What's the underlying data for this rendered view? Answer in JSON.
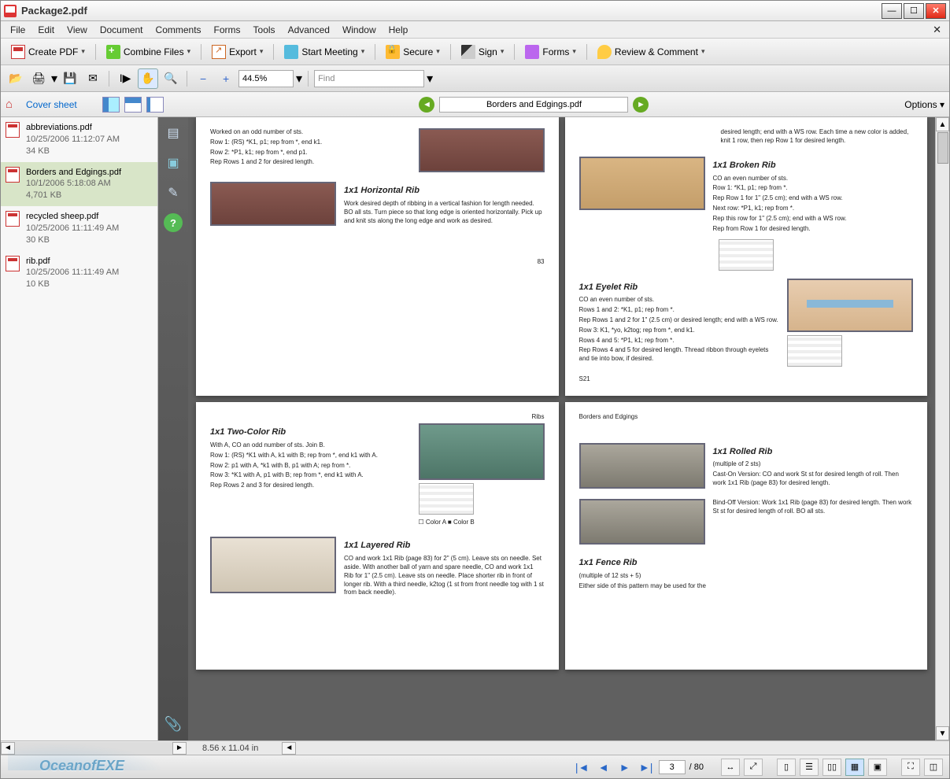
{
  "window": {
    "title": "Package2.pdf"
  },
  "menu": [
    "File",
    "Edit",
    "View",
    "Document",
    "Comments",
    "Forms",
    "Tools",
    "Advanced",
    "Window",
    "Help"
  ],
  "toolbar1": {
    "create": "Create PDF",
    "combine": "Combine Files",
    "export": "Export",
    "meeting": "Start Meeting",
    "secure": "Secure",
    "sign": "Sign",
    "forms": "Forms",
    "review": "Review & Comment"
  },
  "toolbar2": {
    "zoom": "44.5%",
    "find": "Find"
  },
  "navbar": {
    "cover": "Cover sheet",
    "doc": "Borders and Edgings.pdf",
    "options": "Options"
  },
  "files": [
    {
      "name": "abbreviations.pdf",
      "date": "10/25/2006 11:12:07 AM",
      "size": "34 KB"
    },
    {
      "name": "Borders and Edgings.pdf",
      "date": "10/1/2006 5:18:08 AM",
      "size": "4,701 KB"
    },
    {
      "name": "recycled sheep.pdf",
      "date": "10/25/2006 11:11:49 AM",
      "size": "30 KB"
    },
    {
      "name": "rib.pdf",
      "date": "10/25/2006 11:11:49 AM",
      "size": "10 KB"
    }
  ],
  "doc": {
    "p1": {
      "t1": "Worked on an odd number of sts.",
      "t2": "Row 1: (RS) *K1, p1; rep from *, end k1.",
      "t3": "Row 2: *P1, k1; rep from *, end p1.",
      "t4": "Rep Rows 1 and 2 for desired length.",
      "h2": "1x1   Horizontal   Rib",
      "t5": "Work desired depth of ribbing in a vertical fashion for length needed. BO all sts. Turn piece so that long edge is oriented horizontally. Pick up and knit sts along the long edge and work as desired.",
      "pg": "83"
    },
    "p2": {
      "t1": "desired length; end with a WS row. Each time a new color is added, knit 1 row, then rep Row 1 for desired length.",
      "h1": "1x1   Broken   Rib",
      "t2": "CO an even number of sts.",
      "t3": "Row 1: *K1, p1; rep from *.",
      "t4": "Rep Row 1 for 1\" (2.5 cm); end with a WS row.",
      "t5": "Next row: *P1, k1; rep from *.",
      "t6": "Rep this row for 1\" (2.5 cm); end with a WS row.",
      "t7": "Rep from Row 1 for desired length.",
      "h2": "1x1  Eyelet  Rib",
      "e1": "CO an even number of sts.",
      "e2": "Rows 1 and 2: *K1, p1; rep from *.",
      "e3": "Rep Rows 1 and 2 for 1\" (2.5 cm) or desired length; end with a WS row.",
      "e4": "Row 3: K1, *yo, k2tog; rep from *, end k1.",
      "e5": "Rows 4 and 5: *P1, k1; rep from *.",
      "e6": "Rep Rows 4 and 5 for desired length. Thread ribbon through eyelets and tie into bow, if desired.",
      "pg": "S21"
    },
    "p3": {
      "cat": "Ribs",
      "h1": "1x1   Two-Color   Rib",
      "t1": "With A, CO an odd number of sts. Join B.",
      "t2": "Row 1: (RS) *K1 with A, k1 with B; rep from *, end k1 with A.",
      "t3": "Row 2: p1 with A, *k1 with B, p1 with A; rep from *.",
      "t4": "Row 3: *K1 with A, p1 with B; rep from *, end k1 with A.",
      "t5": "Rep Rows 2 and 3 for desired length.",
      "h2": "1x1  Layered  Rib",
      "l1": "CO and work 1x1 Rib (page 83) for 2\" (5 cm). Leave sts on needle. Set aside. With another ball of yarn and spare needle, CO and work 1x1 Rib for 1\" (2.5 cm). Leave sts on needle. Place shorter rib in front of longer rib. With a third needle, k2tog (1 st from front needle tog with 1 st from back needle).",
      "ca": "Color A",
      "cb": "Color B"
    },
    "p4": {
      "cat": "Borders and Edgings",
      "h1": "1x1   Rolled   Rib",
      "t1": "(multiple of 2 sts)",
      "t2": "Cast-On Version: CO and work St st for desired length of roll. Then work 1x1 Rib (page 83) for desired length.",
      "t3": "Bind-Off Version: Work 1x1 Rib (page 83) for desired length. Then work St st for desired length of roll. BO all sts.",
      "h2": "1x1  Fence  Rib",
      "f1": "(multiple of 12 sts + 5)",
      "f2": "Either side of this pattern may be used for the"
    }
  },
  "status": {
    "size": "8.56 x 11.04 in",
    "page": "3",
    "total": "/ 80"
  },
  "watermark": "OceanofEXE"
}
